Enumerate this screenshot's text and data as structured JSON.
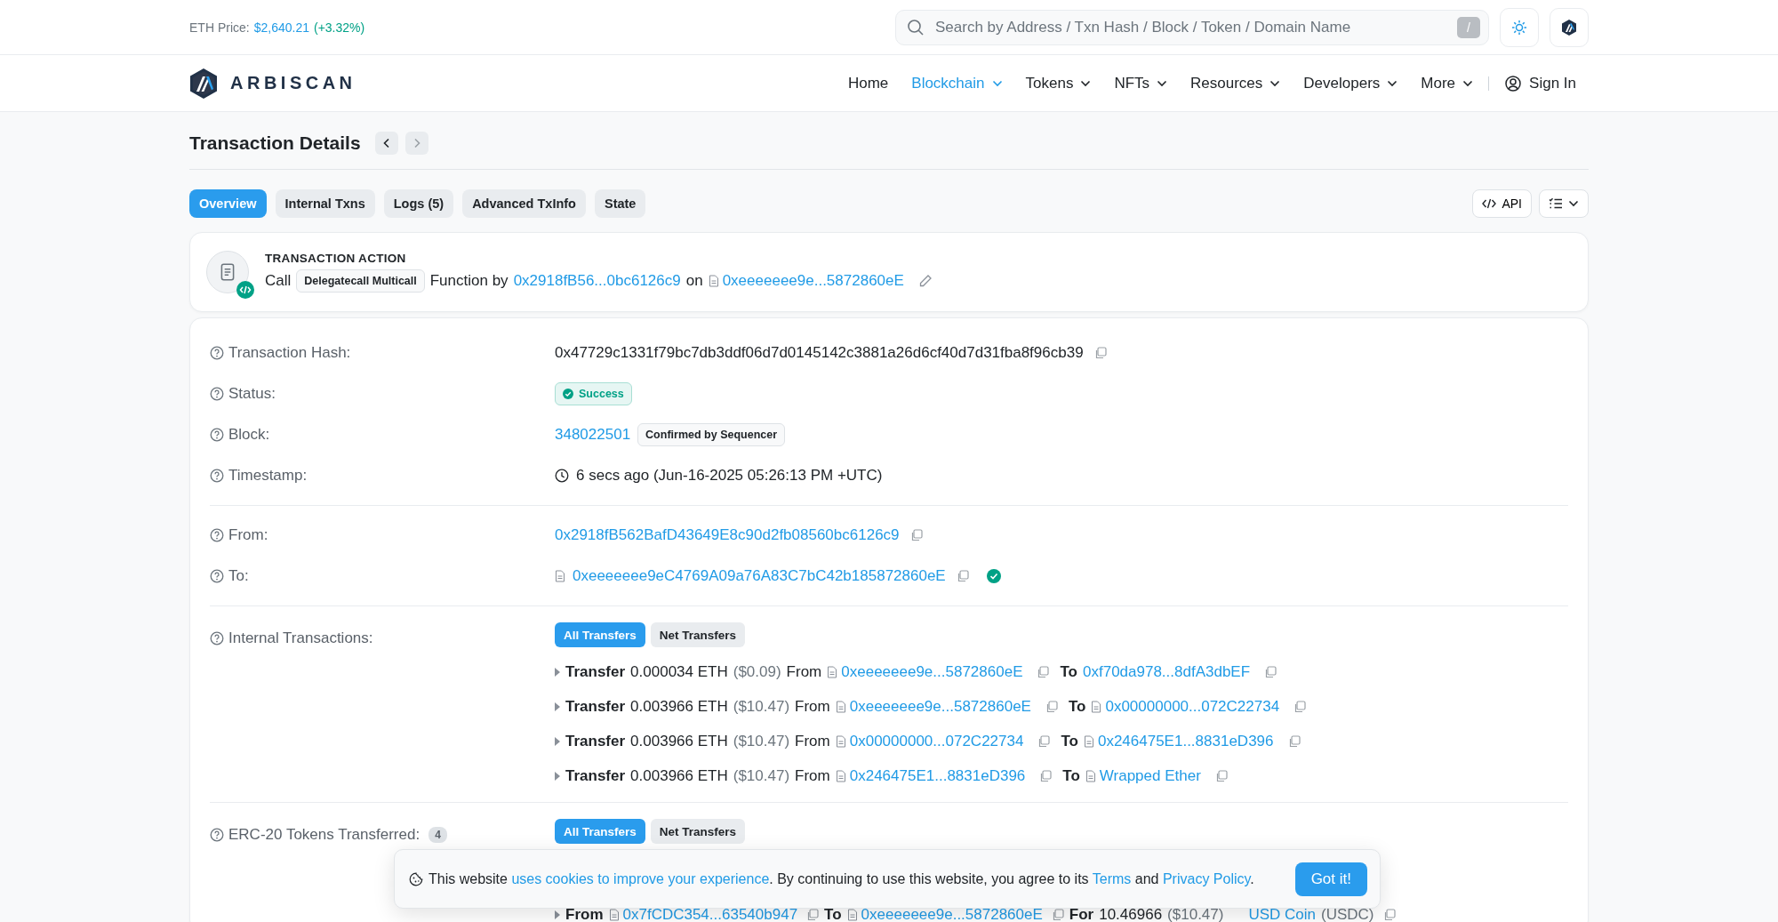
{
  "top_bar": {
    "price_label": "ETH Price:",
    "price": "$2,640.21",
    "change": "(+3.32%)",
    "search": {
      "placeholder": "Search by Address / Txn Hash / Block / Token / Domain Name"
    },
    "shortcut": "/"
  },
  "nav": {
    "logo": "ARBISCAN",
    "items": [
      {
        "label": "Home",
        "selected": false,
        "dropdown": false
      },
      {
        "label": "Blockchain",
        "selected": true,
        "dropdown": true
      },
      {
        "label": "Tokens",
        "selected": false,
        "dropdown": true
      },
      {
        "label": "NFTs",
        "selected": false,
        "dropdown": true
      },
      {
        "label": "Resources",
        "selected": false,
        "dropdown": true
      },
      {
        "label": "Developers",
        "selected": false,
        "dropdown": true
      },
      {
        "label": "More",
        "selected": false,
        "dropdown": true
      }
    ],
    "sign_in": "Sign In"
  },
  "title": "Transaction Details",
  "tabs": [
    {
      "label": "Overview",
      "selected": true
    },
    {
      "label": "Internal Txns",
      "selected": false
    },
    {
      "label": "Logs (5)",
      "selected": false
    },
    {
      "label": "Advanced TxInfo",
      "selected": false
    },
    {
      "label": "State",
      "selected": false
    }
  ],
  "api_button": "API",
  "action": {
    "heading": "TRANSACTION ACTION",
    "verb": "Call",
    "method": "Delegatecall Multicall",
    "by_label": "Function by",
    "from": "0x2918fB56...0bc6126c9",
    "on_label": "on",
    "to": "0xeeeeeee9e...5872860eE"
  },
  "details": [
    {
      "kind": "hash",
      "label": "Transaction Hash:",
      "value": "0x47729c1331f79bc7db3ddf06d7d0145142c3881a26d6cf40d7d31fba8f96cb39"
    },
    {
      "kind": "status",
      "label": "Status:",
      "value": "Success"
    },
    {
      "kind": "block",
      "label": "Block:",
      "value": "348022501",
      "badge": "Confirmed by Sequencer"
    },
    {
      "kind": "timestamp",
      "label": "Timestamp:",
      "value": "6 secs ago (Jun-16-2025 05:26:13 PM +UTC)",
      "divider_after": true
    },
    {
      "kind": "from",
      "label": "From:",
      "value": "0x2918fB562BafD43649E8c90d2fb08560bc6126c9"
    },
    {
      "kind": "to",
      "label": "To:",
      "value": "0xeeeeeee9eC4769A09a76A83C7bC42b185872860eE",
      "verified": true,
      "divider_after": true
    }
  ],
  "internal": {
    "label": "Internal Transactions:",
    "toggles": [
      {
        "label": "All Transfers",
        "selected": true
      },
      {
        "label": "Net Transfers",
        "selected": false
      }
    ],
    "transfers": [
      {
        "word": "Transfer",
        "amount": "0.000034 ETH",
        "usd": "($0.09)",
        "from_label": "From",
        "from": {
          "text": "0xeeeeeee9e...5872860eE",
          "contract": true
        },
        "to_label": "To",
        "to": {
          "text": "0xf70da978...8dfA3dbEF",
          "contract": false
        }
      },
      {
        "word": "Transfer",
        "amount": "0.003966 ETH",
        "usd": "($10.47)",
        "from_label": "From",
        "from": {
          "text": "0xeeeeeee9e...5872860eE",
          "contract": true
        },
        "to_label": "To",
        "to": {
          "text": "0x00000000...072C22734",
          "contract": true
        }
      },
      {
        "word": "Transfer",
        "amount": "0.003966 ETH",
        "usd": "($10.47)",
        "from_label": "From",
        "from": {
          "text": "0x00000000...072C22734",
          "contract": true
        },
        "to_label": "To",
        "to": {
          "text": "0x246475E1...8831eD396",
          "contract": true
        }
      },
      {
        "word": "Transfer",
        "amount": "0.003966 ETH",
        "usd": "($10.47)",
        "from_label": "From",
        "from": {
          "text": "0x246475E1...8831eD396",
          "contract": true
        },
        "to_label": "To",
        "to": {
          "text": "Wrapped Ether",
          "contract": true
        }
      }
    ]
  },
  "erc20": {
    "label": "ERC-20 Tokens Transferred:",
    "count": "4",
    "toggles": [
      {
        "label": "All Transfers",
        "selected": true
      },
      {
        "label": "Net Transfers",
        "selected": false
      }
    ],
    "transfers": [
      {
        "from_label": "From",
        "from": "0x7fCDC354...63540b947",
        "to_label": "To",
        "to": "0xeeeeeee9e...5872860eE",
        "for_label": "For",
        "amount": "10.46966",
        "usd": "($10.47)",
        "token": "USD Coin",
        "symbol": "(USDC)"
      }
    ]
  },
  "cookie": {
    "before": "This website",
    "link": "uses cookies to improve your experience",
    "middle": ". By continuing to use this website, you agree to its",
    "terms": "Terms",
    "and": "and",
    "policy": "Privacy Policy",
    "end": ".",
    "button": "Got it!"
  }
}
